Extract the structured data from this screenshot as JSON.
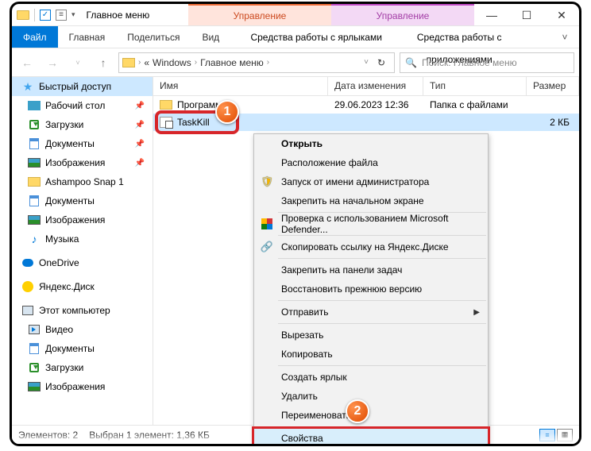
{
  "window": {
    "title": "Главное меню"
  },
  "contextual_tabs": {
    "a": "Управление",
    "b": "Управление"
  },
  "ribbon": {
    "file": "Файл",
    "home": "Главная",
    "share": "Поделиться",
    "view": "Вид",
    "shortcuts": "Средства работы с ярлыками",
    "apps": "Средства работы с приложениями"
  },
  "address": {
    "p1": "«",
    "p2": "Windows",
    "p3": "Главное меню",
    "search_placeholder": "Поиск: Главное меню"
  },
  "columns": {
    "name": "Имя",
    "date": "Дата изменения",
    "type": "Тип",
    "size": "Размер"
  },
  "rows": [
    {
      "name": "Программы",
      "date": "29.06.2023 12:36",
      "type": "Папка с файлами",
      "size": ""
    },
    {
      "name": "TaskKill",
      "date": "",
      "type": "",
      "size": "2 КБ"
    }
  ],
  "tree": {
    "quick": "Быстрый доступ",
    "desktop": "Рабочий стол",
    "downloads": "Загрузки",
    "documents": "Документы",
    "pictures": "Изображения",
    "ashampoo": "Ashampoo Snap 1",
    "documents2": "Документы",
    "pictures2": "Изображения",
    "music": "Музыка",
    "onedrive": "OneDrive",
    "yandex": "Яндекс.Диск",
    "thispc": "Этот компьютер",
    "videos": "Видео",
    "documents3": "Документы",
    "downloads2": "Загрузки",
    "pictures3": "Изображения"
  },
  "menu": {
    "open": "Открыть",
    "filelocation": "Расположение файла",
    "runadmin": "Запуск от имени администратора",
    "pinstart": "Закрепить на начальном экране",
    "defender": "Проверка с использованием Microsoft Defender...",
    "yalink": "Скопировать ссылку на Яндекс.Диске",
    "pintaskbar": "Закрепить на панели задач",
    "restore": "Восстановить прежнюю версию",
    "sendto": "Отправить",
    "cut": "Вырезать",
    "copy": "Копировать",
    "shortcut": "Создать ярлык",
    "delete": "Удалить",
    "rename": "Переименовать",
    "properties": "Свойства"
  },
  "status": {
    "count": "Элементов: 2",
    "sel": "Выбран 1 элемент: 1,36 КБ"
  },
  "badge": {
    "one": "1",
    "two": "2"
  }
}
